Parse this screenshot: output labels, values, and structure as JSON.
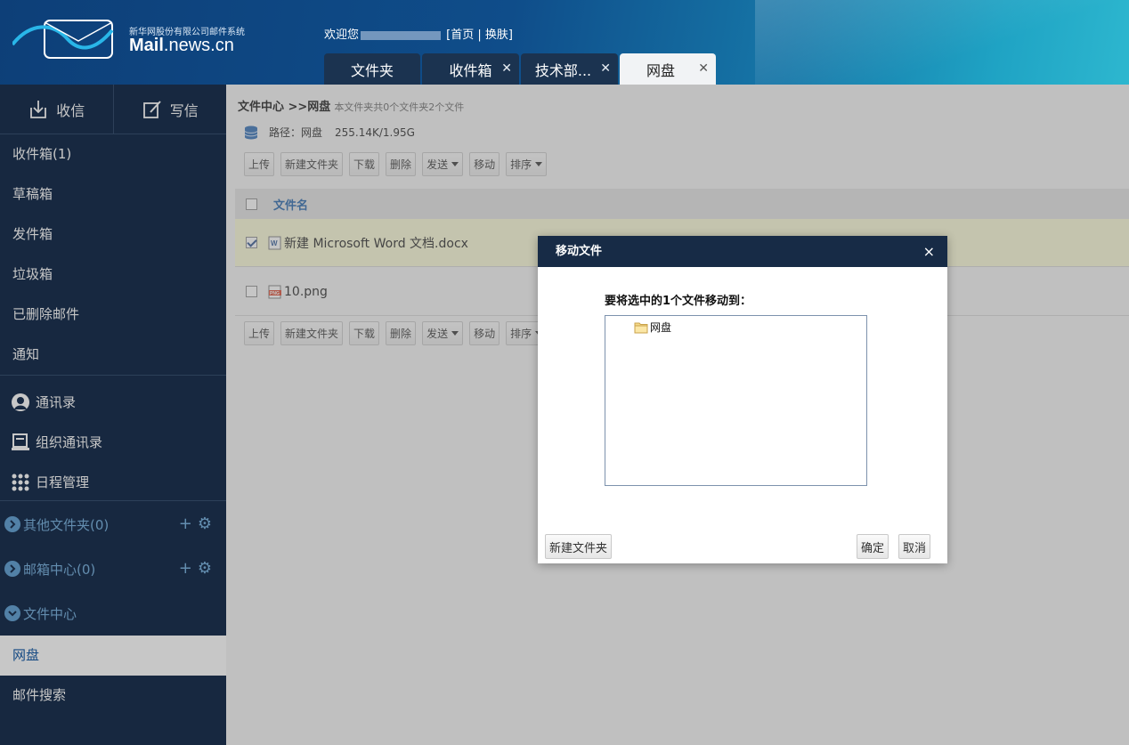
{
  "header": {
    "logo_sub": "新华网股份有限公司邮件系统",
    "logo_main_bold": "Mail",
    "logo_main_rest": ".news.cn",
    "welcome_prefix": "欢迎您",
    "home_link": "[首页",
    "divider": "|",
    "switch_link": "换肤]"
  },
  "tabs": [
    {
      "label": "文件夹",
      "closable": false
    },
    {
      "label": "收件箱",
      "closable": true
    },
    {
      "label": "技术部...",
      "closable": true
    },
    {
      "label": "网盘",
      "closable": true,
      "active": true
    }
  ],
  "sidebar": {
    "receive": "收信",
    "compose": "写信",
    "folders": [
      "收件箱(1)",
      "草稿箱",
      "发件箱",
      "垃圾箱",
      "已删除邮件",
      "通知"
    ],
    "tools": [
      "通讯录",
      "组织通讯录",
      "日程管理"
    ],
    "groups": [
      "其他文件夹(0)",
      "邮箱中心(0)",
      "文件中心"
    ],
    "active_item": "网盘",
    "search": "邮件搜索"
  },
  "content": {
    "breadcrumb": "文件中心 >>网盘",
    "breadcrumb_note": "本文件夹共0个文件夹2个文件",
    "path_label": "路径：网盘",
    "usage": "255.14K/1.95G",
    "toolbar": [
      "上传",
      "新建文件夹",
      "下载",
      "删除",
      "发送",
      "移动",
      "排序"
    ],
    "column_name": "文件名",
    "files": [
      {
        "name": "新建 Microsoft Word 文档.docx",
        "checked": true,
        "icon": "word-doc-icon"
      },
      {
        "name": "10.png",
        "checked": false,
        "icon": "png-file-icon"
      }
    ]
  },
  "dialog": {
    "title": "移动文件",
    "close": "×",
    "prompt": "要将选中的1个文件移动到：",
    "tree_root": "网盘",
    "new_folder": "新建文件夹",
    "ok": "确定",
    "cancel": "取消"
  },
  "colors": {
    "sidebar_bg": "#1e3452",
    "dialog_title_bg": "#172b46",
    "link_blue": "#1a5ea8",
    "selected_row": "#fbfbd6"
  }
}
